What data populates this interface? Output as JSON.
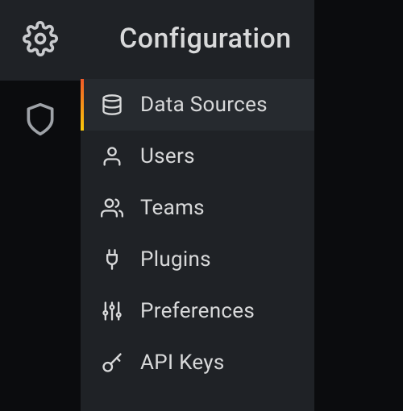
{
  "panel": {
    "title": "Configuration",
    "items": [
      {
        "label": "Data Sources",
        "icon": "database-icon",
        "active": true
      },
      {
        "label": "Users",
        "icon": "user-icon",
        "active": false
      },
      {
        "label": "Teams",
        "icon": "users-icon",
        "active": false
      },
      {
        "label": "Plugins",
        "icon": "plug-icon",
        "active": false
      },
      {
        "label": "Preferences",
        "icon": "sliders-icon",
        "active": false
      },
      {
        "label": "API Keys",
        "icon": "key-icon",
        "active": false
      }
    ]
  },
  "rail": {
    "items": [
      {
        "name": "configuration",
        "icon": "gear-icon",
        "active": true
      },
      {
        "name": "security",
        "icon": "shield-icon",
        "active": false
      }
    ]
  }
}
